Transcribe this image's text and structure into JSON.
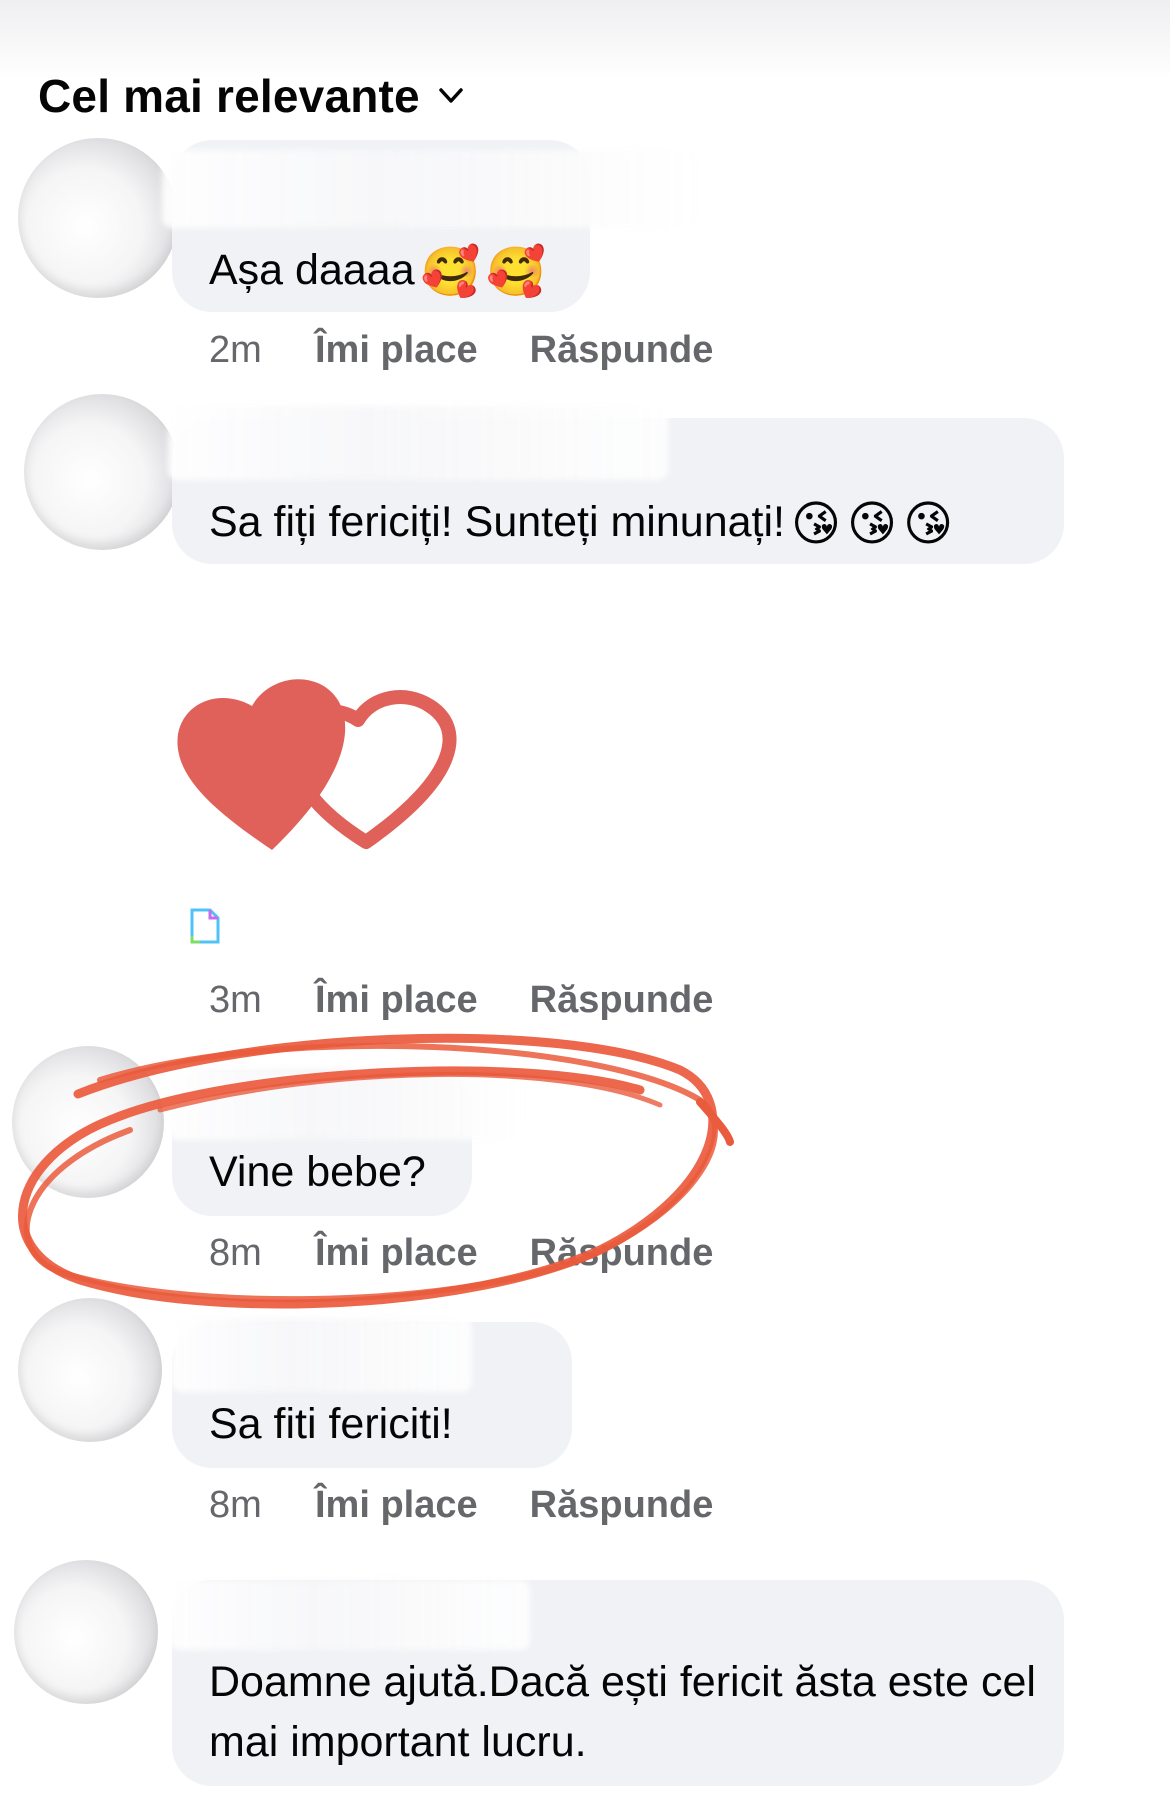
{
  "sort": {
    "label": "Cel mai relevante"
  },
  "comments": [
    {
      "text": "Așa daaaa",
      "emojis": [
        "🥰",
        "🥰"
      ],
      "time": "2m",
      "like": "Îmi place",
      "reply": "Răspunde"
    },
    {
      "text": "Sa fiți fericiți! Sunteți minunați!",
      "emojis": [
        "😘",
        "😘",
        "😘"
      ]
    },
    {
      "sticker": "hearts-sticker",
      "time": "3m",
      "like": "Îmi place",
      "reply": "Răspunde"
    },
    {
      "text": "Vine bebe?",
      "time": "8m",
      "like": "Îmi place",
      "reply": "Răspunde",
      "highlight": "red-hand-drawn-circle"
    },
    {
      "text": "Sa fiti fericiti!",
      "time": "8m",
      "like": "Îmi place",
      "reply": "Răspunde"
    },
    {
      "text": "Doamne ajută.Dacă ești fericit  ăsta este cel mai important lucru."
    }
  ],
  "colors": {
    "bubble": "#f0f2f5",
    "meta_text": "#65676b",
    "heart": "#e0605a",
    "annotation": "#ea5a3c"
  }
}
